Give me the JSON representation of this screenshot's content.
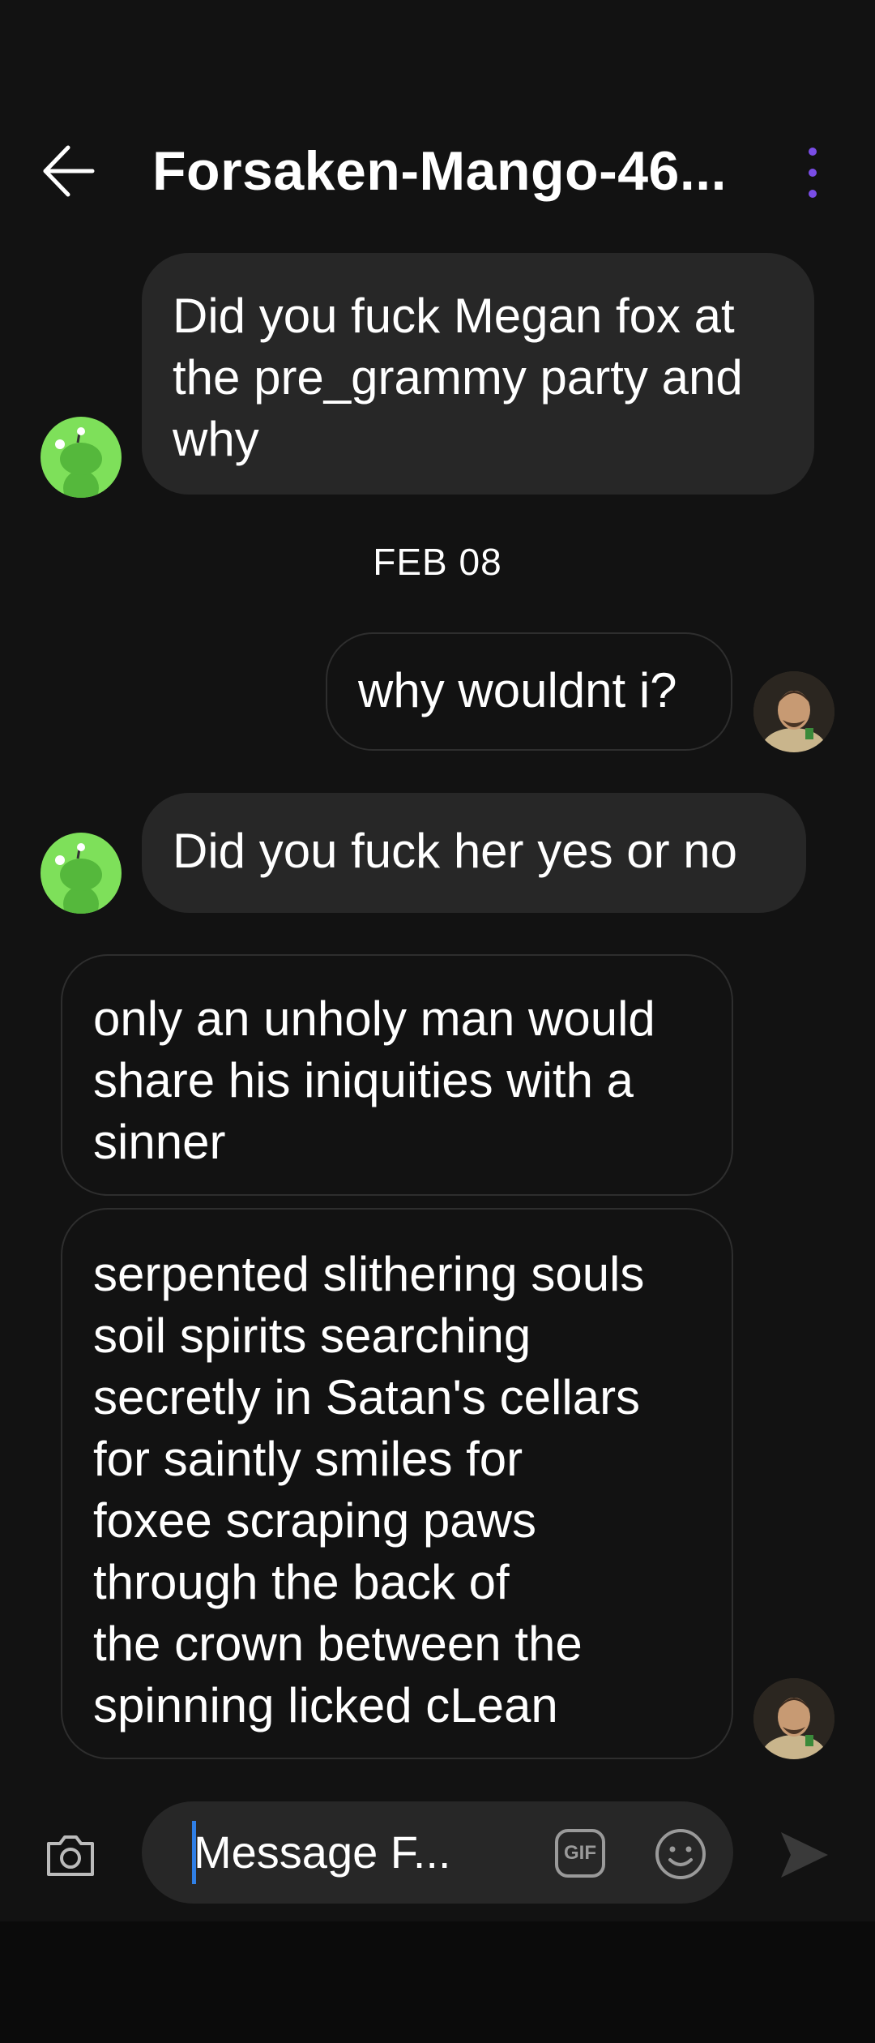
{
  "header": {
    "title": "Forsaken-Mango-46..."
  },
  "messages": [
    {
      "direction": "received",
      "text": "Did you fuck Megan fox at\nthe pre_grammy party and\nwhy"
    },
    {
      "direction": "sent",
      "text": "why wouldnt i?"
    },
    {
      "direction": "received",
      "text": "Did you fuck her yes or no"
    },
    {
      "direction": "sent",
      "text": "only an unholy man would\nshare his iniquities with a\nsinner"
    },
    {
      "direction": "sent",
      "text": "serpented slithering souls\nsoil spirits searching\nsecretly in Satan's cellars\nfor saintly smiles for\nfoxee scraping paws\nthrough the back of\nthe crown between the\nspinning licked cLean"
    }
  ],
  "date_separator": "FEB 08",
  "composer": {
    "placeholder": "Message F...",
    "gif_label": "GIF"
  },
  "colors": {
    "background": "#121212",
    "received_bubble": "#272727",
    "sent_bubble_border": "#2e2e2e",
    "menu_accent": "#7a4de6",
    "snoo_avatar": "#7ee05a",
    "cursor": "#2f7fe6"
  },
  "icons": {
    "back": "back-arrow-icon",
    "menu": "more-vertical-icon",
    "camera": "camera-icon",
    "gif": "gif-icon",
    "emoji": "emoji-icon",
    "send": "send-icon"
  }
}
